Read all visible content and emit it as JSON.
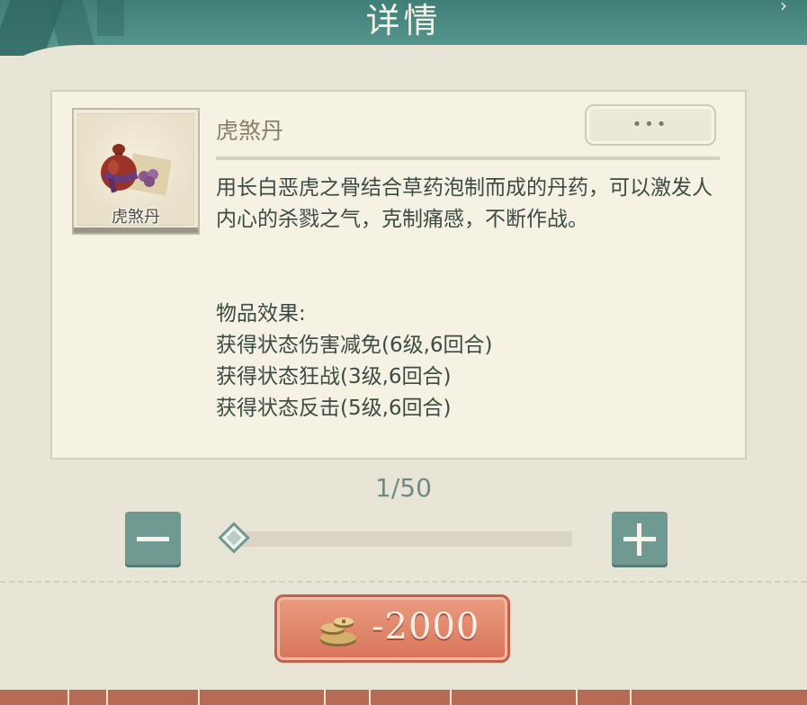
{
  "header": {
    "title": "详情"
  },
  "item": {
    "name": "虎煞丹",
    "caption": "虎煞丹",
    "more_label": "•••",
    "description": "用长白恶虎之骨结合草药泡制而成的丹药，可以激发人内心的杀戮之气，克制痛感，不断作战。",
    "effects_title": "物品效果:",
    "effects": [
      "获得状态伤害减免(6级,6回合)",
      "获得状态狂战(3级,6回合)",
      "获得状态反击(5级,6回合)"
    ]
  },
  "quantity": {
    "current": 1,
    "max": 50,
    "display": "1/50"
  },
  "price": {
    "display": "-2000",
    "currency_icon": "coin-stack-icon"
  },
  "colors": {
    "header": "#4f8c84",
    "button": "#6f9991",
    "price": "#e08a6e"
  }
}
